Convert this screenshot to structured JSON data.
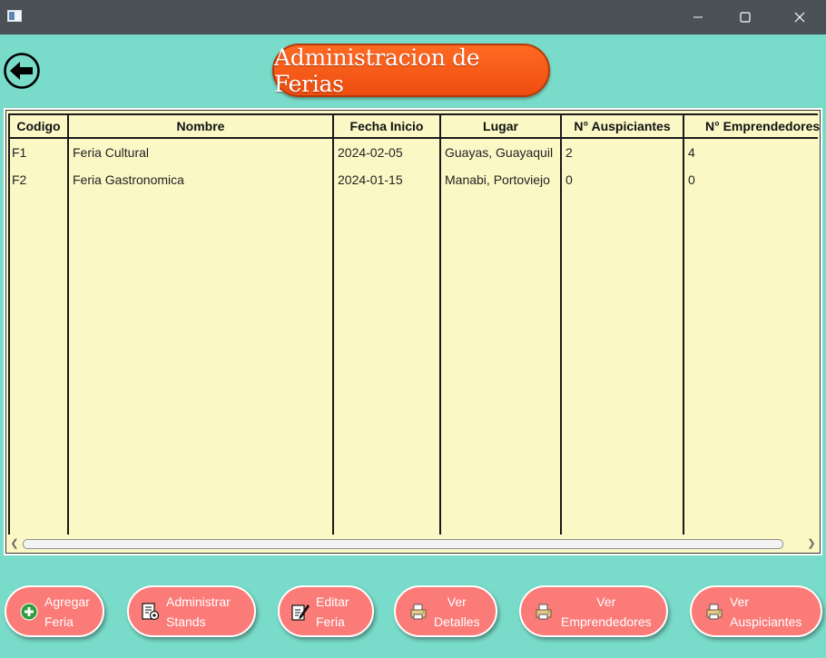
{
  "window": {
    "app_icon": "window-app-icon",
    "controls": [
      "minimize-icon",
      "maximize-icon",
      "close-icon"
    ]
  },
  "header": {
    "title": "Administracion de Ferias",
    "back_icon": "arrow-left-circle-icon"
  },
  "table": {
    "columns": [
      "Codigo",
      "Nombre",
      "Fecha Inicio",
      "Lugar",
      "N° Auspiciantes",
      "N° Emprendedores"
    ],
    "rows": [
      [
        "F1",
        "Feria Cultural",
        "2024-02-05",
        "Guayas, Guayaquil",
        "2",
        "4"
      ],
      [
        "F2",
        "Feria Gastronomica",
        "2024-01-15",
        "Manabi, Portoviejo",
        "0",
        "0"
      ]
    ]
  },
  "buttons": [
    {
      "line1": "Agregar",
      "line2": "Feria",
      "icon": "plus-circle-icon"
    },
    {
      "line1": "Administrar",
      "line2": "Stands",
      "icon": "document-gear-icon"
    },
    {
      "line1": "Editar",
      "line2": "Feria",
      "icon": "edit-pencil-icon"
    },
    {
      "line1": "Ver",
      "line2": "Detalles",
      "icon": "printer-icon"
    },
    {
      "line1": "Ver",
      "line2": "Emprendedores",
      "icon": "printer-icon"
    },
    {
      "line1": "Ver",
      "line2": "Auspiciantes",
      "icon": "printer-icon"
    }
  ],
  "colors": {
    "background": "#79dbc9",
    "title_pill": "#ff5e1a",
    "table_bg": "#fbf8c6",
    "button_bg": "#fa7b78",
    "titlebar": "#4a5157"
  }
}
